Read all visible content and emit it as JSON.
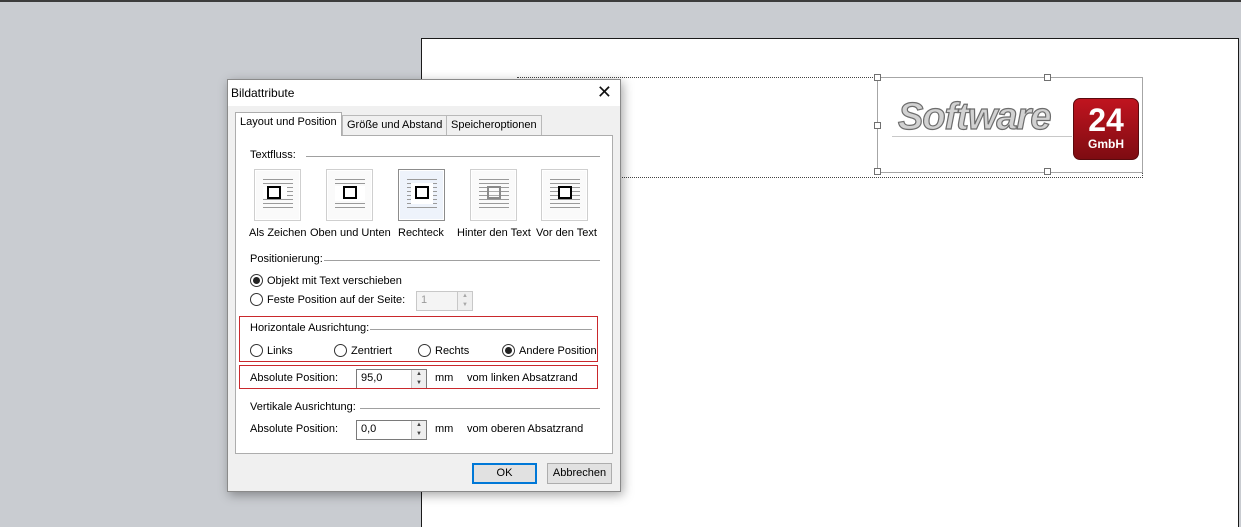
{
  "document": {
    "logo": {
      "word": "Software",
      "number": "24",
      "suffix": "GmbH"
    }
  },
  "dialog": {
    "title": "Bildattribute",
    "close_glyph": "✕",
    "tabs": [
      {
        "label": "Layout und Position",
        "active": true
      },
      {
        "label": "Größe und Abstand",
        "active": false
      },
      {
        "label": "Speicheroptionen",
        "active": false
      }
    ],
    "textfluss": {
      "label": "Textfluss:",
      "options": [
        {
          "label": "Als Zeichen",
          "selected": false
        },
        {
          "label": "Oben und Unten",
          "selected": false
        },
        {
          "label": "Rechteck",
          "selected": true
        },
        {
          "label": "Hinter den Text",
          "selected": false
        },
        {
          "label": "Vor den Text",
          "selected": false
        }
      ]
    },
    "positionierung": {
      "label": "Positionierung:",
      "option_move": "Objekt mit Text verschieben",
      "option_fixed": "Feste Position auf der Seite:",
      "page_value": "1",
      "selected": "move"
    },
    "horizontal": {
      "label": "Horizontale Ausrichtung:",
      "options": [
        "Links",
        "Zentriert",
        "Rechts",
        "Andere Position"
      ],
      "selected": "Andere Position",
      "abs_label": "Absolute Position:",
      "abs_value": "95,0",
      "unit": "mm",
      "reference": "vom linken Absatzrand"
    },
    "vertical": {
      "label": "Vertikale Ausrichtung:",
      "abs_label": "Absolute Position:",
      "abs_value": "0,0",
      "unit": "mm",
      "reference": "vom oberen Absatzrand"
    },
    "buttons": {
      "ok": "OK",
      "cancel": "Abbrechen"
    },
    "colors": {
      "highlight_box": "#c9282c",
      "default_button_border": "#0078d7",
      "logo_red": "#a5101a"
    }
  }
}
